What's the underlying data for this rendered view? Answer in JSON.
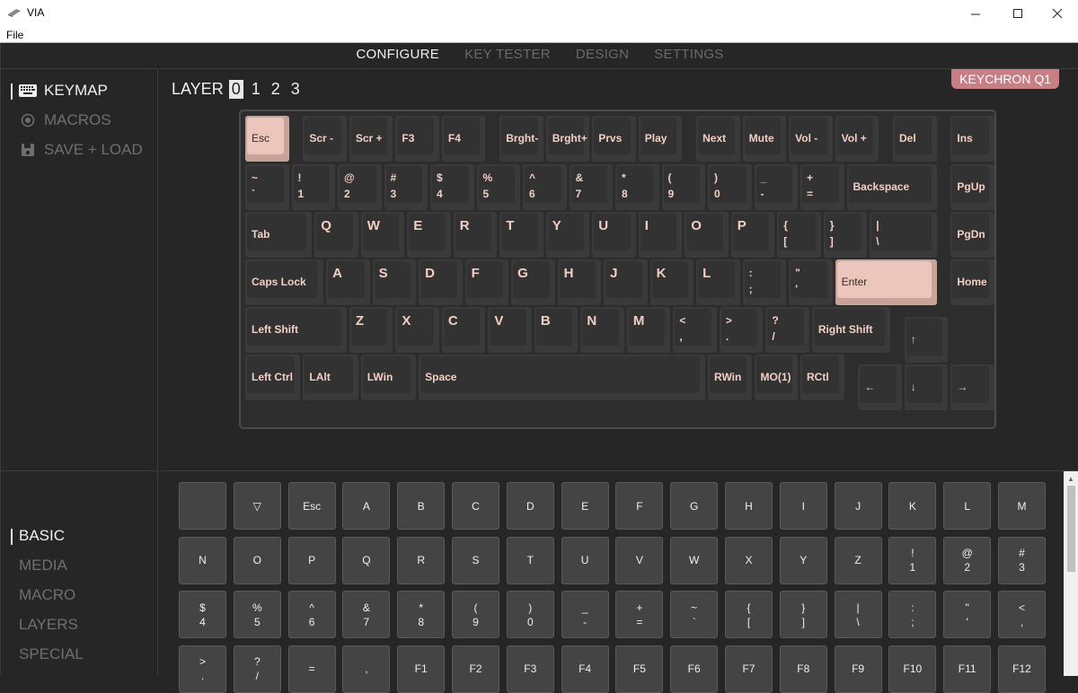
{
  "window": {
    "title": "VIA",
    "menu": [
      "File"
    ]
  },
  "nav": {
    "tabs": [
      "CONFIGURE",
      "KEY TESTER",
      "DESIGN",
      "SETTINGS"
    ],
    "active": 0
  },
  "upper_sidebar": {
    "items": [
      "KEYMAP",
      "MACROS",
      "SAVE + LOAD"
    ],
    "active": 0,
    "icons": [
      "keyboard-icon",
      "record-icon",
      "floppy-disk-icon"
    ]
  },
  "lower_sidebar": {
    "items": [
      "BASIC",
      "MEDIA",
      "MACRO",
      "LAYERS",
      "SPECIAL"
    ],
    "active": 0
  },
  "layers": {
    "label": "LAYER",
    "values": [
      "0",
      "1",
      "2",
      "3"
    ],
    "active": 0
  },
  "keyboard_name": "KEYCHRON Q1",
  "colors": {
    "accent": "#c77e84",
    "key_legend": "#f2cfc5",
    "selected_key": "#ecc6bc"
  },
  "keymap": {
    "rows": [
      [
        [
          "Esc"
        ],
        [
          "Scr -"
        ],
        [
          "Scr +"
        ],
        [
          "F3"
        ],
        [
          "F4"
        ],
        [
          "Brght-"
        ],
        [
          "Brght+"
        ],
        [
          "Prvs"
        ],
        [
          "Play"
        ],
        [
          "Next"
        ],
        [
          "Mute"
        ],
        [
          "Vol -"
        ],
        [
          "Vol +"
        ],
        [
          "Del"
        ],
        [
          "Ins"
        ]
      ],
      [
        [
          "~",
          "`"
        ],
        [
          "!",
          "1"
        ],
        [
          "@",
          "2"
        ],
        [
          "#",
          "3"
        ],
        [
          "$",
          "4"
        ],
        [
          "%",
          "5"
        ],
        [
          "^",
          "6"
        ],
        [
          "&",
          "7"
        ],
        [
          "*",
          "8"
        ],
        [
          "(",
          "9"
        ],
        [
          ")",
          "0"
        ],
        [
          "_",
          "-"
        ],
        [
          "+",
          "="
        ],
        [
          "Backspace"
        ],
        [
          "PgUp"
        ]
      ],
      [
        [
          "Tab"
        ],
        [
          "Q"
        ],
        [
          "W"
        ],
        [
          "E"
        ],
        [
          "R"
        ],
        [
          "T"
        ],
        [
          "Y"
        ],
        [
          "U"
        ],
        [
          "I"
        ],
        [
          "O"
        ],
        [
          "P"
        ],
        [
          "{",
          "["
        ],
        [
          "}",
          "]"
        ],
        [
          "|",
          "\\"
        ],
        [
          "PgDn"
        ]
      ],
      [
        [
          "Caps Lock"
        ],
        [
          "A"
        ],
        [
          "S"
        ],
        [
          "D"
        ],
        [
          "F"
        ],
        [
          "G"
        ],
        [
          "H"
        ],
        [
          "J"
        ],
        [
          "K"
        ],
        [
          "L"
        ],
        [
          ":",
          ";"
        ],
        [
          "\"",
          "'"
        ],
        [
          "Enter"
        ],
        [
          "Home"
        ]
      ],
      [
        [
          "Left Shift"
        ],
        [
          "Z"
        ],
        [
          "X"
        ],
        [
          "C"
        ],
        [
          "V"
        ],
        [
          "B"
        ],
        [
          "N"
        ],
        [
          "M"
        ],
        [
          "<",
          ","
        ],
        [
          ">",
          "."
        ],
        [
          "?",
          "/"
        ],
        [
          "Right Shift"
        ],
        [
          "↑"
        ]
      ],
      [
        [
          "Left Ctrl"
        ],
        [
          "LAlt"
        ],
        [
          "LWin"
        ],
        [
          "Space"
        ],
        [
          "RWin"
        ],
        [
          "MO(1)"
        ],
        [
          "RCtl"
        ],
        [
          "←"
        ],
        [
          "↓"
        ],
        [
          "→"
        ]
      ]
    ],
    "selected": [
      "Esc",
      "Enter"
    ]
  },
  "keycodes": [
    [
      "",
      "▽",
      "Esc",
      "A",
      "B",
      "C",
      "D",
      "E",
      "F",
      "G",
      "H",
      "I",
      "J",
      "K",
      "L",
      "M"
    ],
    [
      "N",
      "O",
      "P",
      "Q",
      "R",
      "S",
      "T",
      "U",
      "V",
      "W",
      "X",
      "Y",
      "Z",
      "!\n1",
      "@\n2",
      "#\n3"
    ],
    [
      "$\n4",
      "%\n5",
      "^\n6",
      "&\n7",
      "*\n8",
      "(\n9",
      ")\n0",
      "_\n-",
      "+\n=",
      "~\n`",
      "{\n[",
      "}\n]",
      "|\n\\",
      ":\n;",
      "\"\n'",
      "<\n,"
    ],
    [
      ">\n.",
      "?\n/",
      "=",
      ",",
      "F1",
      "F2",
      "F3",
      "F4",
      "F5",
      "F6",
      "F7",
      "F8",
      "F9",
      "F10",
      "F11",
      "F12"
    ]
  ]
}
